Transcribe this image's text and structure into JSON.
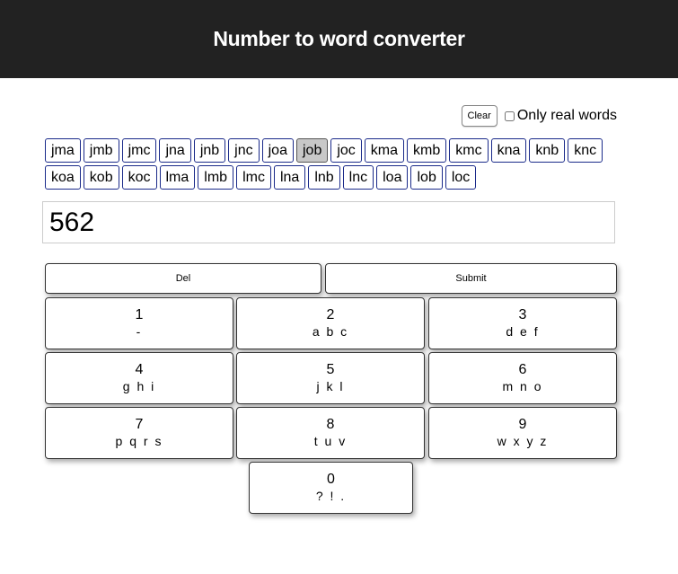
{
  "header": {
    "title": "Number to word converter"
  },
  "toolbar": {
    "clear_label": "Clear",
    "only_real_words_label": "Only real words",
    "only_real_words_checked": false
  },
  "suggestions": [
    "jma",
    "jmb",
    "jmc",
    "jna",
    "jnb",
    "jnc",
    "joa",
    "job",
    "joc",
    "kma",
    "kmb",
    "kmc",
    "kna",
    "knb",
    "knc",
    "koa",
    "kob",
    "koc",
    "lma",
    "lmb",
    "lmc",
    "lna",
    "lnb",
    "lnc",
    "loa",
    "lob",
    "loc"
  ],
  "selected_suggestion": "job",
  "display": {
    "value": "562"
  },
  "actions": {
    "del_label": "Del",
    "submit_label": "Submit"
  },
  "keys": [
    {
      "num": "1",
      "letters": "-"
    },
    {
      "num": "2",
      "letters": "a b c"
    },
    {
      "num": "3",
      "letters": "d e f"
    },
    {
      "num": "4",
      "letters": "g h i"
    },
    {
      "num": "5",
      "letters": "j k l"
    },
    {
      "num": "6",
      "letters": "m n o"
    },
    {
      "num": "7",
      "letters": "p q r s"
    },
    {
      "num": "8",
      "letters": "t u v"
    },
    {
      "num": "9",
      "letters": "w x y z"
    },
    {
      "num": "0",
      "letters": "? ! ."
    }
  ]
}
